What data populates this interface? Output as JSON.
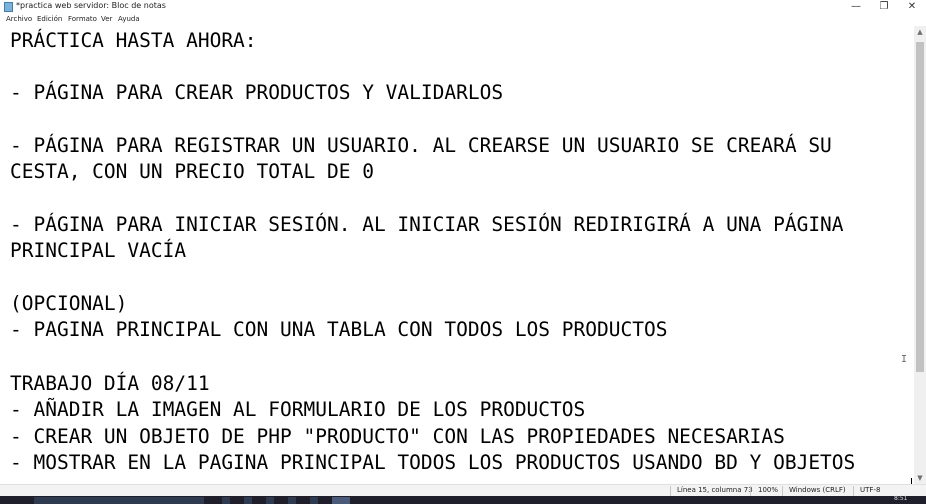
{
  "window": {
    "title": "*practica web servidor: Bloc de notas",
    "minimize_glyph": "—",
    "maximize_glyph": "❐",
    "close_glyph": "✕"
  },
  "menu": [
    "Archivo",
    "Edición",
    "Formato",
    "Ver",
    "Ayuda"
  ],
  "document": {
    "lines": [
      "PRÁCTICA HASTA AHORA:",
      "",
      "- PÁGINA PARA CREAR PRODUCTOS Y VALIDARLOS",
      "",
      "- PÁGINA PARA REGISTRAR UN USUARIO. AL CREARSE UN USUARIO SE CREARÁ SU",
      "CESTA, CON UN PRECIO TOTAL DE 0",
      "",
      "- PÁGINA PARA INICIAR SESIÓN. AL INICIAR SESIÓN REDIRIGIRÁ A UNA PÁGINA",
      "PRINCIPAL VACÍA",
      "",
      "(OPCIONAL)",
      "- PAGINA PRINCIPAL CON UNA TABLA CON TODOS LOS PRODUCTOS",
      "",
      "TRABAJO DÍA 08/11",
      "- AÑADIR LA IMAGEN AL FORMULARIO DE LOS PRODUCTOS",
      "- CREAR UN OBJETO DE PHP \"PRODUCTO\" CON LAS PROPIEDADES NECESARIAS",
      "- MOSTRAR EN LA PAGINA PRINCIPAL TODOS LOS PRODUCTOS USANDO BD Y OBJETOS"
    ]
  },
  "status": {
    "position": "Línea 15, columna 73",
    "zoom": "100%",
    "line_ending": "Windows (CRLF)",
    "encoding": "UTF-8"
  },
  "taskbar": {
    "clock": "8:51"
  }
}
